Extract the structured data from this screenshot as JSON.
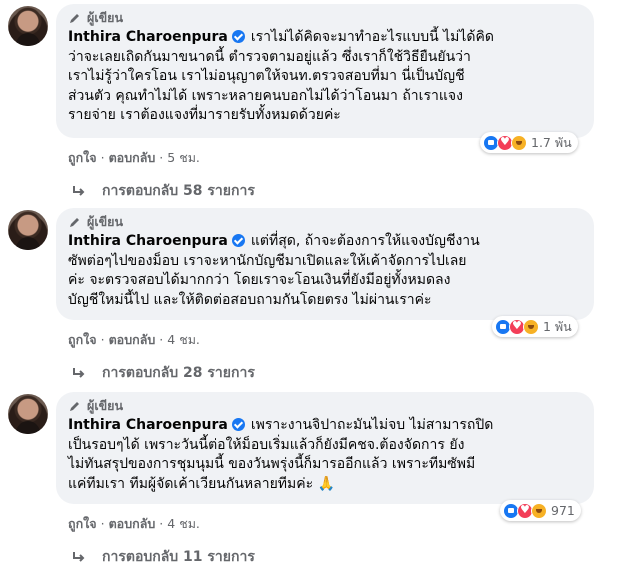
{
  "comments": [
    {
      "author_tag": "ผู้เขียน",
      "name": "Inthira Charoenpura",
      "lines": [
        "เราไม่ได้คิดจะมาทำอะไรแบบนี้ ไม่ได้คิด",
        "ว่าจะเลยเถิดกันมาขนาดนี้ ตำรวจตามอยู่แล้ว ซึ่งเราก็ใช้วิธียืนยันว่า",
        "เราไม่รู้ว่าใครโอน เราไม่อนุญาตให้จนท.ตรวจสอบที่มา นี่เป็นบัญชี",
        "ส่วนตัว คุณทำไม่ได้ เพราะหลายคนบอกไม่ได้ว่าโอนมา ถ้าเราแจง",
        "รายจ่าย เราต้องแจงที่มารายรับทั้งหมดด้วยค่ะ"
      ],
      "reaction_count": "1.7 พัน",
      "like": "ถูกใจ",
      "reply": "ตอบกลับ",
      "time": "5 ชม.",
      "replies_label": "การตอบกลับ 58 รายการ"
    },
    {
      "author_tag": "ผู้เขียน",
      "name": "Inthira Charoenpura",
      "lines": [
        "แต่ที่สุด, ถ้าจะต้องการให้แจงบัญชีงาน",
        "ซัพต่อๆไปของม็อบ เราจะหานักบัญชีมาเปิดและให้เค้าจัดการไปเลย",
        "ค่ะ จะตรวจสอบได้มากกว่า โดยเราจะโอนเงินที่ยังมีอยู่ทั้งหมดลง",
        "บัญชีใหม่นี้ไป และให้ติดต่อสอบถามกันโดยตรง ไม่ผ่านเราค่ะ"
      ],
      "reaction_count": "1 พัน",
      "like": "ถูกใจ",
      "reply": "ตอบกลับ",
      "time": "4 ชม.",
      "replies_label": "การตอบกลับ 28 รายการ"
    },
    {
      "author_tag": "ผู้เขียน",
      "name": "Inthira Charoenpura",
      "lines": [
        "เพราะงานจิปาถะมันไม่จบ ไม่สามารถปิด",
        "เป็นรอบๆได้ เพราะวันนี้ต่อให้ม็อบเริ่มแล้วก็ยังมีคชจ.ต้องจัดการ ยัง",
        "ไม่ทันสรุปของการชุมนุมนี้ ของวันพรุ่งนี้ก็มารออีกแล้ว เพราะทีมซัพมี",
        "แค่ทีมเรา ทีมผู้จัดเค้าเวียนกันหลายทีมค่ะ 🙏"
      ],
      "reaction_count": "971",
      "like": "ถูกใจ",
      "reply": "ตอบกลับ",
      "time": "4 ชม.",
      "replies_label": "การตอบกลับ 11 รายการ"
    }
  ],
  "icons": {
    "author_tag": "pen-icon",
    "verified": "verified-badge-icon",
    "reactions": [
      "like-icon",
      "love-icon",
      "care-icon"
    ],
    "reply_arrow": "reply-arrow-icon"
  },
  "colors": {
    "bubble": "#f0f2f5",
    "secondary_text": "#65676b",
    "verified": "#1877f2",
    "like": "#1877f2",
    "love": "#f33e58",
    "care": "#f7b125"
  }
}
